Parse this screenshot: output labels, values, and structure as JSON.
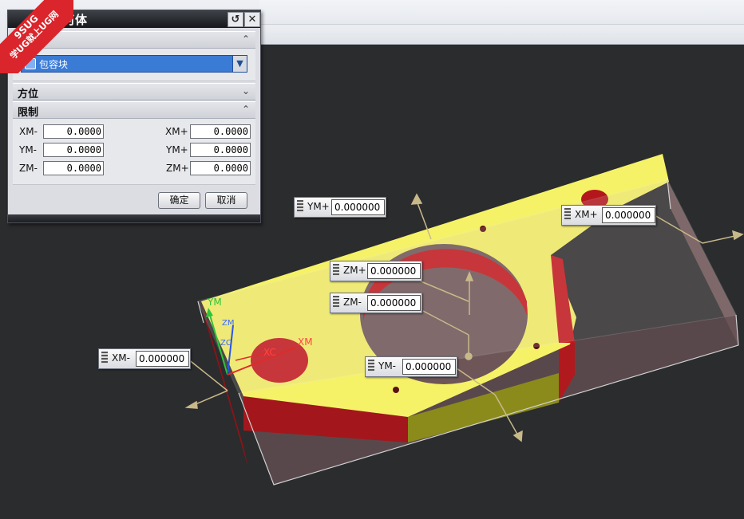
{
  "dialog": {
    "title": "几何体",
    "sections": {
      "type": {
        "label": "类型",
        "select_value": "包容块"
      },
      "orientation": {
        "label": "方位"
      },
      "limits": {
        "label": "限制"
      }
    },
    "limits": {
      "xm_minus": {
        "label": "XM-",
        "value": "0.0000"
      },
      "ym_minus": {
        "label": "YM-",
        "value": "0.0000"
      },
      "zm_minus": {
        "label": "ZM-",
        "value": "0.0000"
      },
      "xm_plus": {
        "label": "XM+",
        "value": "0.0000"
      },
      "ym_plus": {
        "label": "YM+",
        "value": "0.0000"
      },
      "zm_plus": {
        "label": "ZM+",
        "value": "0.0000"
      }
    },
    "ok_label": "确定",
    "cancel_label": "取消"
  },
  "watermark": {
    "line1": "9SUG",
    "line2": "学UG就上UG网"
  },
  "viewport_tags": {
    "ym_plus": {
      "label": "YM+",
      "value": "0.000000"
    },
    "xm_plus": {
      "label": "XM+",
      "value": "0.000000"
    },
    "zm_plus": {
      "label": "ZM+",
      "value": "0.000000"
    },
    "zm_minus": {
      "label": "ZM-",
      "value": "0.000000"
    },
    "xm_minus": {
      "label": "XM-",
      "value": "0.000000"
    },
    "ym_minus": {
      "label": "YM-",
      "value": "0.000000"
    }
  },
  "triad": {
    "ym": "YM",
    "zm": "ZM",
    "xm": "XM",
    "xc": "XC",
    "zc": "ZC"
  },
  "colors": {
    "part_top": "#f5f268",
    "part_side": "#b9181e",
    "block": "#6e5658",
    "background": "#2b2c2e",
    "handle": "#c8b98a"
  }
}
